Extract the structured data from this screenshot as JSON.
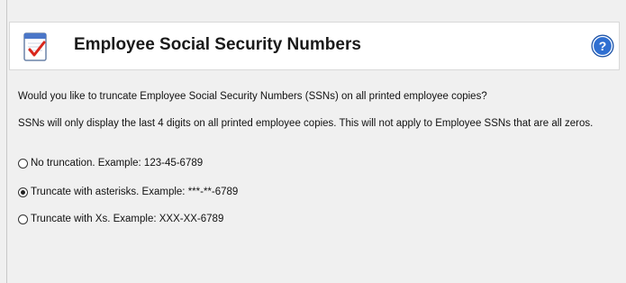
{
  "header": {
    "title": "Employee Social Security Numbers",
    "icon": "checklist-document-icon",
    "help_icon": "help-question-icon"
  },
  "body": {
    "question": "Would you like to truncate Employee Social Security Numbers (SSNs) on all printed employee copies?",
    "info": "SSNs will only display the last 4 digits on all printed employee copies. This will not apply to Employee SSNs that are all zeros."
  },
  "options": [
    {
      "label": "No truncation. Example: 123-45-6789",
      "selected": false
    },
    {
      "label": "Truncate with asterisks. Example: ***-**-6789",
      "selected": true
    },
    {
      "label": "Truncate with Xs. Example: XXX-XX-6789",
      "selected": false
    }
  ],
  "colors": {
    "help_blue": "#2f6fd1",
    "check_red": "#d9261c"
  }
}
